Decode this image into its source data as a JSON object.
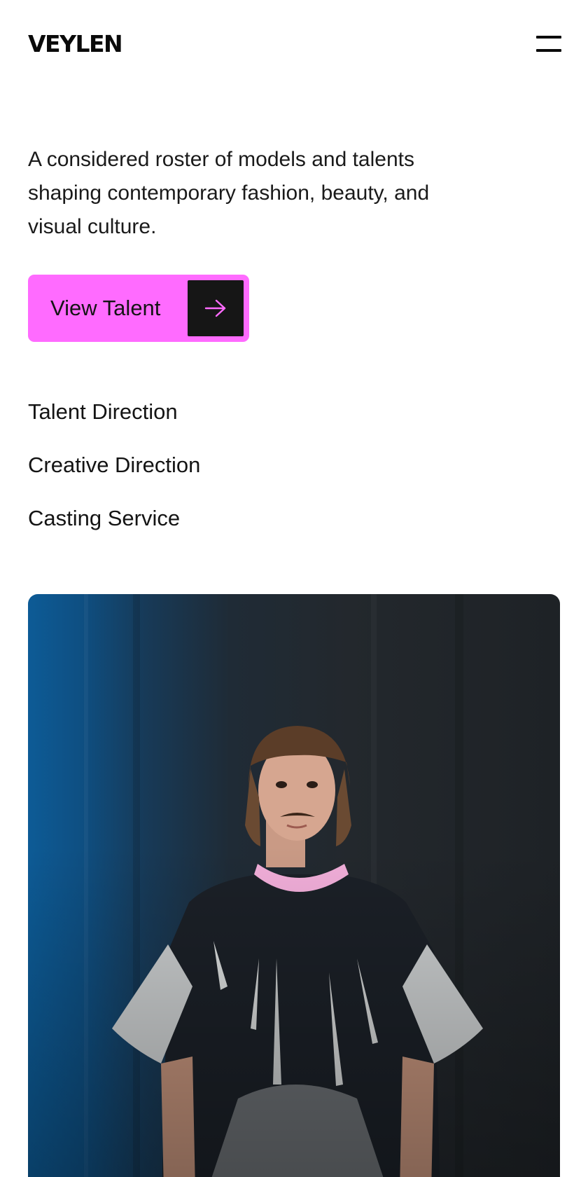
{
  "header": {
    "logo": "VEYLEN",
    "menu_icon": "hamburger-menu-icon"
  },
  "intro": {
    "text": "A considered roster of models and talents shaping contemporary fashion, beauty, and visual culture."
  },
  "cta": {
    "label": "View Talent",
    "icon": "arrow-right-icon",
    "bg_color": "#ff6bff",
    "icon_bg_color": "#161616",
    "icon_color": "#ff6bff"
  },
  "services": [
    {
      "label": "Talent Direction"
    },
    {
      "label": "Creative Direction"
    },
    {
      "label": "Casting Service"
    }
  ],
  "hero": {
    "subject": "portrait-photo",
    "accent_color": "#0d5b96"
  }
}
